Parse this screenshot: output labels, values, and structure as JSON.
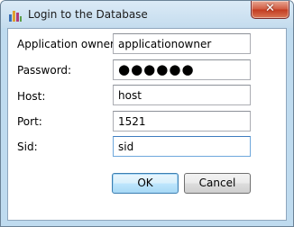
{
  "window": {
    "title": "Login to the Database",
    "close_glyph": "✕",
    "app_icon": "database-app-icon"
  },
  "form": {
    "fields": [
      {
        "label": "Application owner:",
        "value": "applicationowner",
        "type": "text"
      },
      {
        "label": "Password:",
        "value": "●●●●●●",
        "type": "password"
      },
      {
        "label": "Host:",
        "value": "host",
        "type": "text"
      },
      {
        "label": "Port:",
        "value": "1521",
        "type": "text"
      },
      {
        "label": "Sid:",
        "value": "sid",
        "type": "text",
        "focused": true
      }
    ]
  },
  "buttons": {
    "ok_label": "OK",
    "cancel_label": "Cancel"
  },
  "colors": {
    "window_frame": "#bfdbef",
    "default_button": "#bee6fd",
    "close_button": "#c23a20"
  }
}
